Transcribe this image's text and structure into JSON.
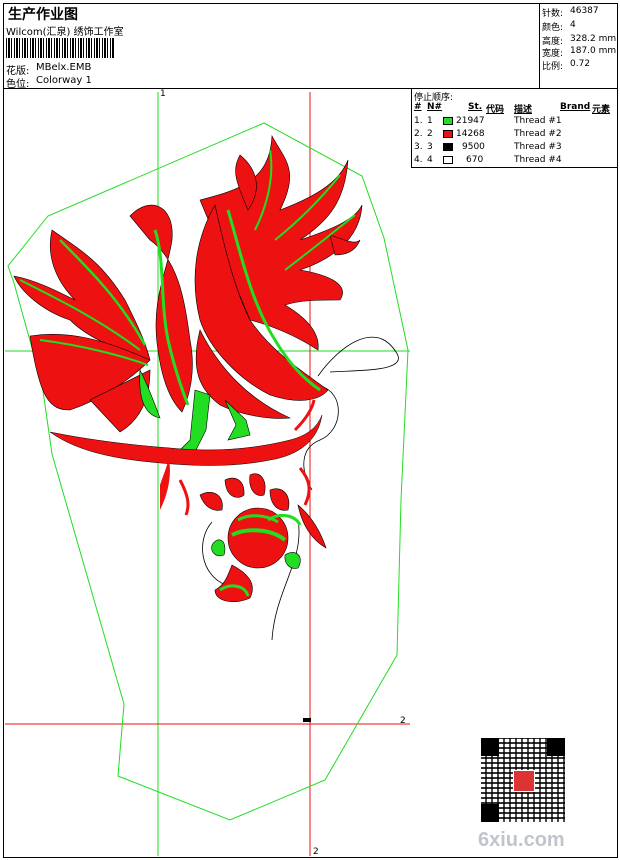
{
  "header": {
    "title": "生产作业图",
    "studio": "Wilcom(汇泉) 绣饰工作室",
    "design_label": "花版:",
    "design_value": "MBelx.EMB",
    "colorway_label": "色位:",
    "colorway_value": "Colorway 1"
  },
  "stats": {
    "stitches_label": "针数:",
    "stitches_value": "46387",
    "colors_label": "颜色:",
    "colors_value": "4",
    "height_label": "高度:",
    "height_value": "328.2 mm",
    "width_label": "宽度:",
    "width_value": "187.0 mm",
    "scale_label": "比例:",
    "scale_value": "0.72"
  },
  "stop_sequence": {
    "title": "停止顺序:",
    "columns": {
      "num": "#",
      "needle": "N#",
      "stitches": "St.",
      "code": "代码",
      "desc": "描述",
      "brand": "Brand",
      "element": "元素"
    },
    "rows": [
      {
        "num": "1.",
        "needle": "1",
        "color": "#22dd22",
        "stitches": "21947",
        "desc": "Thread #1"
      },
      {
        "num": "2.",
        "needle": "2",
        "color": "#ee1111",
        "stitches": "14268",
        "desc": "Thread #2"
      },
      {
        "num": "3.",
        "needle": "3",
        "color": "#000000",
        "stitches": "9500",
        "desc": "Thread #3"
      },
      {
        "num": "4.",
        "needle": "4",
        "color": "#ffffff",
        "stitches": "670",
        "desc": "Thread #4"
      }
    ]
  },
  "canvas": {
    "guide1_label": "1",
    "guide2_label": "2",
    "guide2_bottom_label": "2",
    "green_guide_color": "#22dd22",
    "red_guide_color": "#ee1111"
  },
  "watermark": {
    "qr_icon": "qr-code-icon",
    "text": "6xiu.com"
  }
}
